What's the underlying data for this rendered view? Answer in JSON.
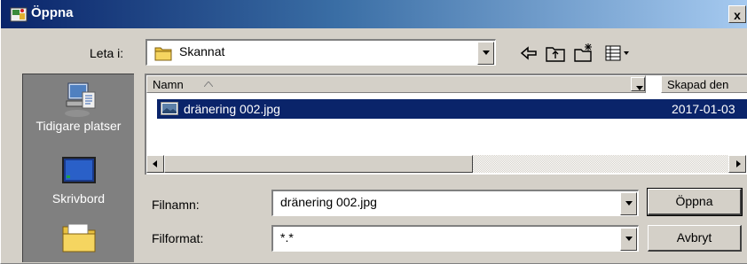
{
  "dialog": {
    "title": "Öppna",
    "close_label": "x"
  },
  "lookin": {
    "label": "Leta i:",
    "value": "Skannat"
  },
  "toolbar": {
    "icons": [
      "back-icon",
      "up-folder-icon",
      "new-folder-icon",
      "view-menu-icon"
    ]
  },
  "places": [
    {
      "label": "Tidigare platser",
      "icon": "recent-places-icon"
    },
    {
      "label": "Skrivbord",
      "icon": "desktop-icon"
    },
    {
      "label": "",
      "icon": "documents-folder-icon"
    }
  ],
  "list": {
    "columns": [
      "Namn",
      "Skapad den"
    ],
    "files": [
      {
        "name": "dränering 002.jpg",
        "created": "2017-01-03",
        "selected": true
      }
    ]
  },
  "filename": {
    "label": "Filnamn:",
    "value": "dränering 002.jpg"
  },
  "filetype": {
    "label": "Filformat:",
    "value": "*.*"
  },
  "buttons": {
    "open": "Öppna",
    "cancel": "Avbryt"
  },
  "colors": {
    "title_start": "#0a246a",
    "title_end": "#a6caf0",
    "selection": "#0a246a",
    "face": "#d4d0c8"
  }
}
